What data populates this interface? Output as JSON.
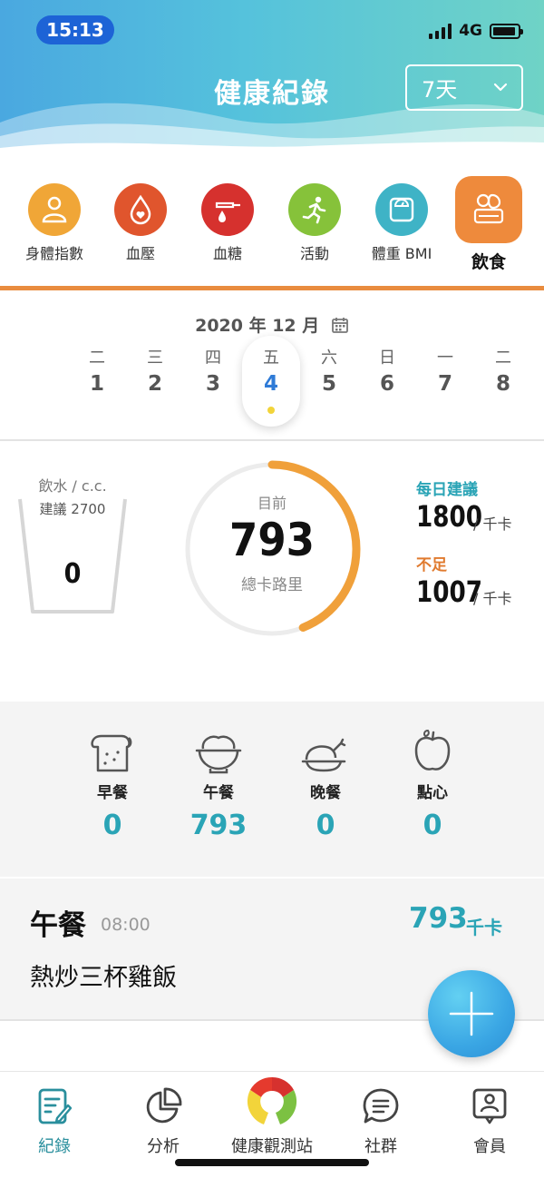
{
  "status": {
    "time": "15:13",
    "network": "4G"
  },
  "header": {
    "title": "健康紀錄",
    "range": "7天"
  },
  "categories": [
    {
      "label": "身體指數",
      "icon": "person-icon",
      "color": "#f0a637"
    },
    {
      "label": "血壓",
      "icon": "heart-drop-icon",
      "color": "#e0552d"
    },
    {
      "label": "血糖",
      "icon": "blood-sugar-icon",
      "color": "#d6312e"
    },
    {
      "label": "活動",
      "icon": "running-icon",
      "color": "#86c23a"
    },
    {
      "label": "體重 BMI",
      "icon": "scale-icon",
      "color": "#3fb3c6"
    },
    {
      "label": "飲食",
      "icon": "food-icon",
      "color": "#ee8a3c",
      "active": true
    }
  ],
  "calendar": {
    "month": "2020 年 12 月",
    "days": [
      {
        "wd": "二",
        "d": "1"
      },
      {
        "wd": "三",
        "d": "2"
      },
      {
        "wd": "四",
        "d": "3"
      },
      {
        "wd": "五",
        "d": "4"
      },
      {
        "wd": "六",
        "d": "5"
      },
      {
        "wd": "日",
        "d": "6"
      },
      {
        "wd": "一",
        "d": "7"
      },
      {
        "wd": "二",
        "d": "8"
      }
    ],
    "selected_index": 3
  },
  "water": {
    "label": "飲水 / c.c.",
    "suggest": "建議 2700",
    "value": "0"
  },
  "calories": {
    "caption": "目前",
    "value": "793",
    "unit": "總卡路里",
    "progress": 0.44,
    "recommended_label": "每日建議",
    "recommended_value": "1800",
    "recommended_unit": "/ 千卡",
    "shortfall_label": "不足",
    "shortfall_value": "1007",
    "shortfall_unit": "/ 千卡"
  },
  "meals": [
    {
      "name": "早餐",
      "value": "0",
      "icon": "bread-icon"
    },
    {
      "name": "午餐",
      "value": "793",
      "icon": "rice-bowl-icon"
    },
    {
      "name": "晚餐",
      "value": "0",
      "icon": "roast-chicken-icon"
    },
    {
      "name": "點心",
      "value": "0",
      "icon": "apple-icon"
    }
  ],
  "entry": {
    "meal": "午餐",
    "time": "08:00",
    "calories": "793",
    "unit": "千卡",
    "food": "熱炒三杯雞飯"
  },
  "tabs": [
    {
      "label": "紀錄",
      "icon": "record-icon",
      "active": true
    },
    {
      "label": "分析",
      "icon": "pie-chart-icon"
    },
    {
      "label": "健康觀測站",
      "icon": "health-station-icon"
    },
    {
      "label": "社群",
      "icon": "chat-icon"
    },
    {
      "label": "會員",
      "icon": "member-icon"
    }
  ],
  "colors": {
    "accent_teal": "#2aa4b6",
    "accent_orange": "#ee8a3c",
    "gauge_orange": "#f0a03a",
    "active_date": "#2f7bd7"
  }
}
